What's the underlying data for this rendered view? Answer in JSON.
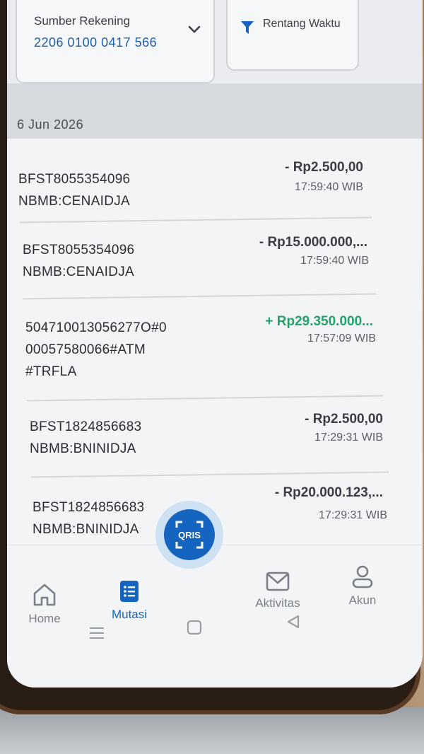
{
  "filter": {
    "source_label": "Sumber Rekening",
    "source_value": "2206 0100 0417 566",
    "range_label": "Rentang Waktu"
  },
  "date_header": "6 Jun 2026",
  "transactions": [
    {
      "desc": "BFST8055354096 NBMB:CENAIDJA",
      "amount": "- Rp2.500,00",
      "time": "17:59:40 WIB",
      "type": "debit"
    },
    {
      "desc": "BFST8055354096 NBMB:CENAIDJA",
      "amount": "- Rp15.000.000,...",
      "time": "17:59:40 WIB",
      "type": "debit"
    },
    {
      "desc": "504710013056277O#0 00057580066#ATM #TRFLA",
      "amount": "+ Rp29.350.000...",
      "time": "17:57:09 WIB",
      "type": "credit"
    },
    {
      "desc": "BFST1824856683 NBMB:BNINIDJA",
      "amount": "- Rp2.500,00",
      "time": "17:29:31 WIB",
      "type": "debit"
    },
    {
      "desc": "BFST1824856683 NBMB:BNINIDJA",
      "amount": "- Rp20.000.123,...",
      "time": "17:29:31 WIB",
      "type": "debit"
    }
  ],
  "nav": {
    "home": "Home",
    "mutasi": "Mutasi",
    "qris": "QRIS",
    "aktivitas": "Aktivitas",
    "akun": "Akun"
  },
  "colors": {
    "accent": "#1565c0",
    "credit": "#23a36a"
  },
  "icons": [
    "chevron-down-icon",
    "filter-icon",
    "home-icon",
    "list-icon",
    "qris-icon",
    "mail-icon",
    "user-icon",
    "menu-icon",
    "square-icon",
    "back-icon"
  ]
}
